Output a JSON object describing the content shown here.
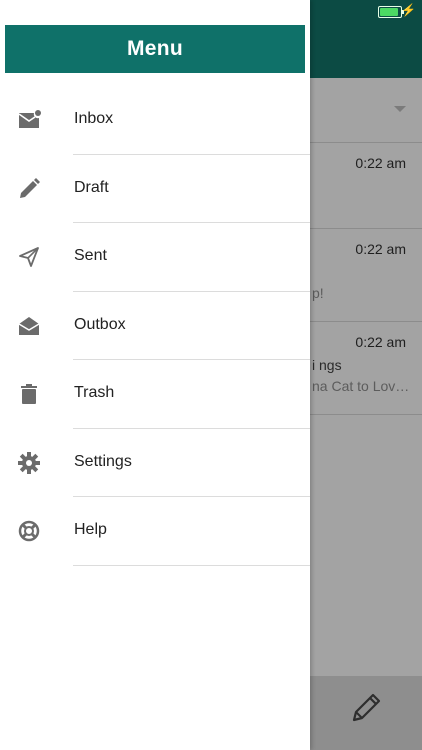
{
  "status": {
    "battery_icon": "battery-icon",
    "charging_icon": "bolt-icon"
  },
  "menu": {
    "title": "Menu",
    "items": [
      {
        "label": "Inbox",
        "icon": "inbox-icon"
      },
      {
        "label": "Draft",
        "icon": "pencil-icon"
      },
      {
        "label": "Sent",
        "icon": "send-icon"
      },
      {
        "label": "Outbox",
        "icon": "open-envelope-icon"
      },
      {
        "label": "Trash",
        "icon": "trash-icon"
      },
      {
        "label": "Settings",
        "icon": "gear-icon"
      },
      {
        "label": "Help",
        "icon": "lifebuoy-icon"
      }
    ]
  },
  "background": {
    "messages": [
      {
        "time": "0:22 am",
        "preview": ""
      },
      {
        "time": "0:22 am",
        "preview": "p!"
      },
      {
        "time": "0:22 am",
        "subject": "i ngs",
        "preview": "na Cat to Lov…"
      }
    ],
    "compose_icon": "compose-icon"
  },
  "colors": {
    "header": "#0f7169",
    "dimmed_header": "#0c4b44"
  }
}
